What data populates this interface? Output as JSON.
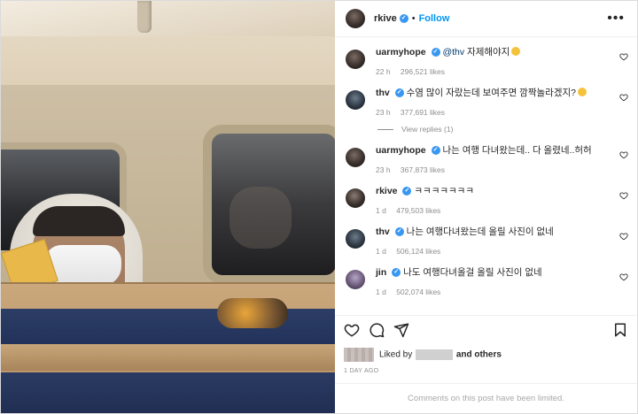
{
  "post": {
    "author": "rkive",
    "follow_label": "Follow",
    "separator": "•",
    "more_label": "•••",
    "verified_mark": "✓"
  },
  "comments": [
    {
      "user": "uarmyhope",
      "mention": "@thv",
      "text": "자제해야지",
      "time": "22 h",
      "likes": "296,521 likes",
      "emoji": true
    },
    {
      "user": "thv",
      "mention": "",
      "text": "수염 많이 자랐는데 보여주면 깜짝놀라겠지?",
      "time": "23 h",
      "likes": "377,691 likes",
      "emoji": true
    },
    {
      "user": "uarmyhope",
      "mention": "",
      "text": "나는 여행 다녀왔는데.. 다 올렸네..허허",
      "time": "23 h",
      "likes": "367,873 likes",
      "emoji": false
    },
    {
      "user": "rkive",
      "mention": "",
      "text": "ㅋㅋㅋㅋㅋㅋㅋ",
      "time": "1 d",
      "likes": "479,503 likes",
      "emoji": false
    },
    {
      "user": "thv",
      "mention": "",
      "text": "나는 여행다녀왔는데 올릴 사진이 없네",
      "time": "1 d",
      "likes": "506,124 likes",
      "emoji": false
    },
    {
      "user": "jin",
      "mention": "",
      "text": "나도 여행다녀올걸 올릴 사진이 없네",
      "time": "1 d",
      "likes": "502,074 likes",
      "emoji": false
    }
  ],
  "view_replies": "View replies (1)",
  "liked_by": {
    "prefix": "Liked by",
    "suffix": "and others"
  },
  "date": "1 DAY AGO",
  "limited": "Comments on this post have been limited.",
  "colors": {
    "accent": "#0095f6",
    "verified": "#3897f0",
    "muted": "#8e8e8e"
  }
}
